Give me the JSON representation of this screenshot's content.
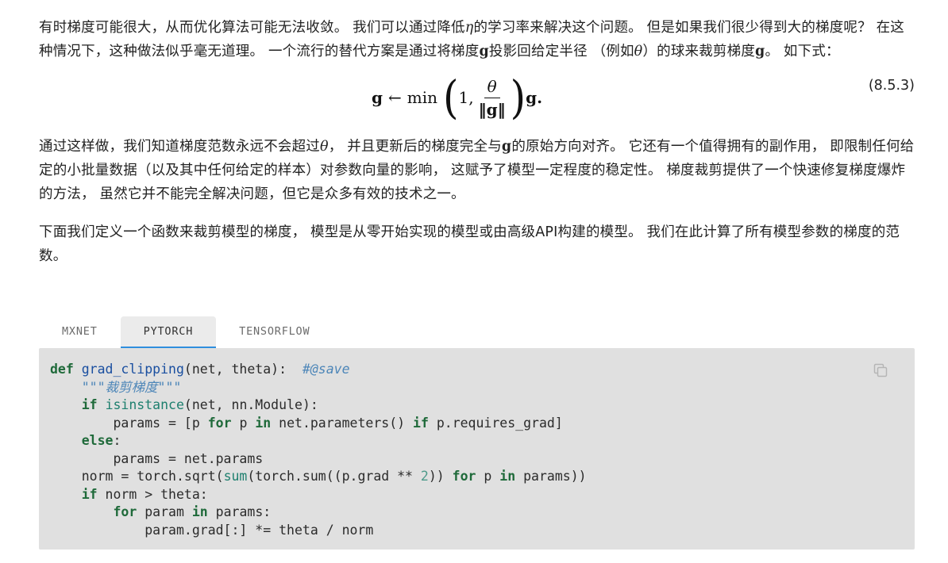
{
  "paragraph1": {
    "t1": "有时梯度可能很大，从而优化算法可能无法收敛。 我们可以通过降低",
    "eta": "η",
    "t2": "的学习率来解决这个问题。 但是如果我们很少得到大的梯度呢？ 在这种情况下，这种做法似乎毫无道理。 一个流行的替代方案是通过将梯度",
    "g1": "g",
    "t3": "投影回给定半径 （例如",
    "theta": "θ",
    "t4": "）的球来裁剪梯度",
    "g2": "g",
    "t5": "。 如下式："
  },
  "equation": {
    "lhs": "g",
    "arrow": "←",
    "fn": "min",
    "one": "1,",
    "numerator": "θ",
    "denominator": "‖g‖",
    "rhs": "g.",
    "number": "(8.5.3)"
  },
  "paragraph2": {
    "t1": "通过这样做，我们知道梯度范数永远不会超过",
    "theta": "θ",
    "t2": "， 并且更新后的梯度完全与",
    "g": "g",
    "t3": "的原始方向对齐。 它还有一个值得拥有的副作用， 即限制任何给定的小批量数据（以及其中任何给定的样本）对参数向量的影响， 这赋予了模型一定程度的稳定性。 梯度裁剪提供了一个快速修复梯度爆炸的方法， 虽然它并不能完全解决问题，但它是众多有效的技术之一。"
  },
  "paragraph3": "下面我们定义一个函数来裁剪模型的梯度， 模型是从零开始实现的模型或由高级API构建的模型。 我们在此计算了所有模型参数的梯度的范数。",
  "tabs": [
    {
      "label": "MXNET",
      "active": false
    },
    {
      "label": "PYTORCH",
      "active": true
    },
    {
      "label": "TENSORFLOW",
      "active": false
    }
  ],
  "code": {
    "copy_icon": "copy-icon",
    "l1_def": "def",
    "l1_fn": "grad_clipping",
    "l1_args": "(net, theta):",
    "l1_comment": "#@save",
    "l2_doc": "\"\"\"裁剪梯度\"\"\"",
    "l3_if": "if",
    "l3_isinstance": "isinstance",
    "l3_rest": "(net, nn.Module):",
    "l4_a": "params = [p ",
    "l4_for": "for",
    "l4_b": " p ",
    "l4_in": "in",
    "l4_c": " net.parameters() ",
    "l4_if": "if",
    "l4_d": " p.requires_grad]",
    "l5_else": "else",
    "l5_colon": ":",
    "l6": "params = net.params",
    "l7_a": "norm = torch.sqrt(",
    "l7_sum": "sum",
    "l7_b": "(torch.sum((p.grad ** ",
    "l7_two": "2",
    "l7_c": ")) ",
    "l7_for": "for",
    "l7_d": " p ",
    "l7_in": "in",
    "l7_e": " params))",
    "l8_if": "if",
    "l8_rest": " norm > theta:",
    "l9_for": "for",
    "l9_b": " param ",
    "l9_in": "in",
    "l9_c": " params:",
    "l10": "param.grad[:] *= theta / norm"
  }
}
